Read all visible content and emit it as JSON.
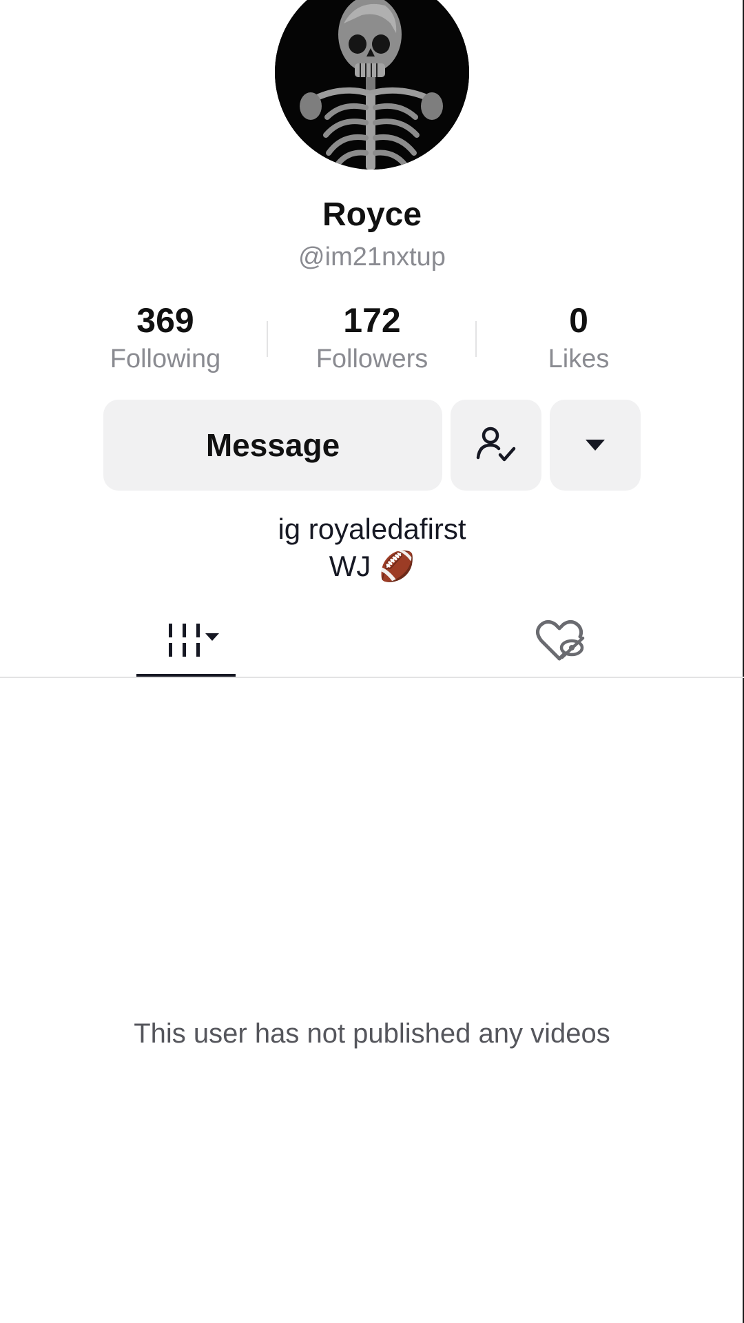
{
  "profile": {
    "display_name": "Royce",
    "username": "@im21nxtup",
    "avatar_icon": "skeleton-avatar"
  },
  "stats": [
    {
      "value": "369",
      "label": "Following"
    },
    {
      "value": "172",
      "label": "Followers"
    },
    {
      "value": "0",
      "label": "Likes"
    }
  ],
  "actions": {
    "message_label": "Message",
    "follow_status_icon": "person-check-icon",
    "more_icon": "caret-down-icon"
  },
  "bio": {
    "line1": "ig royaledafirst",
    "line2": "WJ 🏈"
  },
  "tabs": [
    {
      "name": "videos",
      "icon": "grid-icon",
      "active": true
    },
    {
      "name": "liked",
      "icon": "hidden-heart-icon",
      "active": false
    }
  ],
  "empty_state": {
    "message": "This user has not published any videos"
  },
  "colors": {
    "text_primary": "#161823",
    "text_secondary": "#8a8b91",
    "button_bg": "#f1f1f2",
    "divider": "#e3e3e4"
  }
}
